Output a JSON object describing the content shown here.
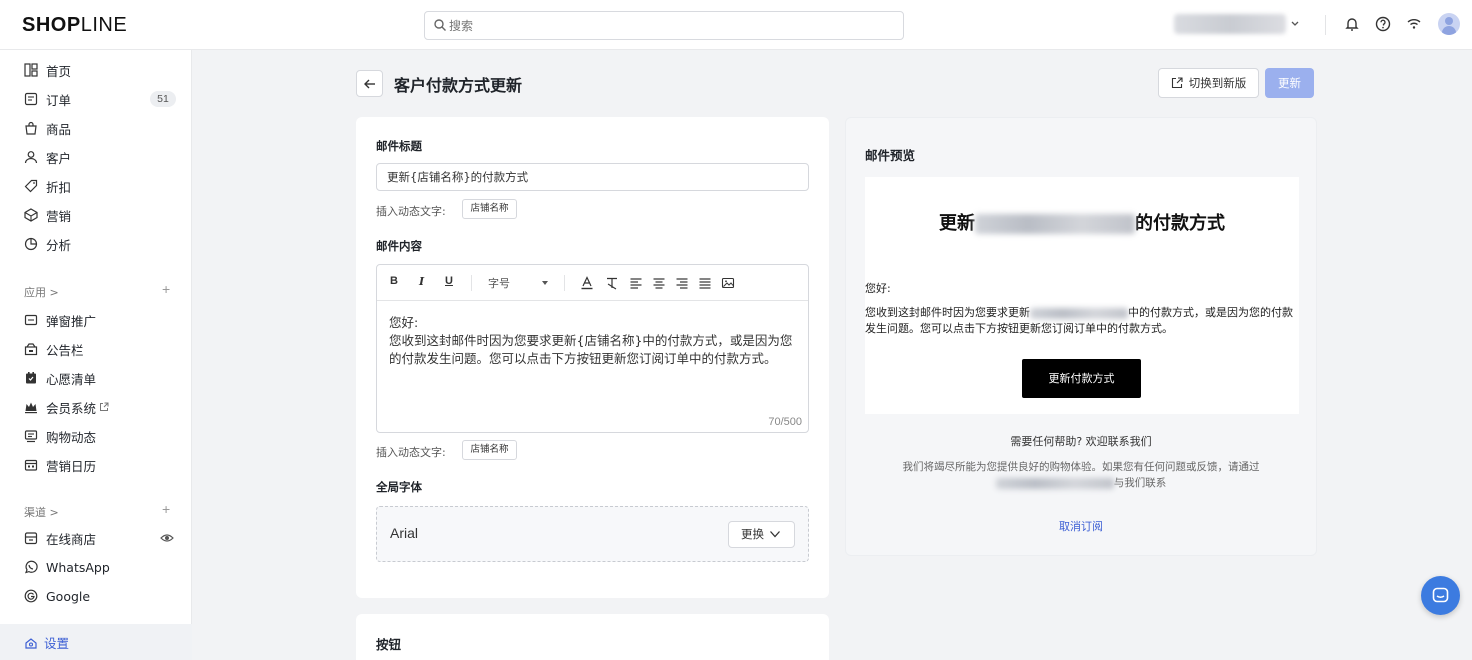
{
  "brand": {
    "logo_bold": "SH",
    "logo_o": "O",
    "logo_p": "P",
    "logo_light": "LINE"
  },
  "search": {
    "placeholder": "搜索"
  },
  "sidebar": {
    "items": [
      {
        "label": "首页",
        "icon": "home-icon"
      },
      {
        "label": "订单",
        "icon": "order-icon",
        "badge": "51"
      },
      {
        "label": "商品",
        "icon": "bag-icon"
      },
      {
        "label": "客户",
        "icon": "user-icon"
      },
      {
        "label": "折扣",
        "icon": "tag-icon"
      },
      {
        "label": "营销",
        "icon": "target-icon"
      },
      {
        "label": "分析",
        "icon": "chart-pie-icon"
      }
    ],
    "apps_label": "应用 >",
    "apps": [
      {
        "label": "弹窗推广",
        "icon": "popup-icon"
      },
      {
        "label": "公告栏",
        "icon": "announcement-icon"
      },
      {
        "label": "心愿清单",
        "icon": "wishlist-icon"
      },
      {
        "label": "会员系统",
        "icon": "crown-icon"
      },
      {
        "label": "购物动态",
        "icon": "activity-icon"
      },
      {
        "label": "营销日历",
        "icon": "calendar-icon"
      }
    ],
    "channels_label": "渠道 >",
    "channels": [
      {
        "label": "在线商店",
        "icon": "store-icon"
      },
      {
        "label": "WhatsApp",
        "icon": "whatsapp-icon"
      },
      {
        "label": "Google",
        "icon": "google-icon"
      }
    ],
    "settings_label": "设置"
  },
  "header": {
    "title": "客户付款方式更新",
    "switch_label": "切换到新版",
    "update_label": "更新"
  },
  "form": {
    "subject_label": "邮件标题",
    "subject_value": "更新{店铺名称}的付款方式",
    "insert_label": "插入动态文字:",
    "insert_tag": "店铺名称",
    "content_label": "邮件内容",
    "toolbar": {
      "bold": "B",
      "italic": "I",
      "underline": "U",
      "font_size": "字号"
    },
    "content_line1": "您好:",
    "content_line2": "您收到这封邮件时因为您要求更新{店铺名称}中的付款方式，或是因为您的付款发生问题。您可以点击下方按钮更新您订阅订单中的付款方式。",
    "counter": "70/500",
    "global_font_label": "全局字体",
    "font_value": "Arial",
    "change_label": "更换",
    "button_section_label": "按钮"
  },
  "preview": {
    "title": "邮件预览",
    "heading_pre": "更新",
    "heading_post": "的付款方式",
    "hello": "您好:",
    "body_pre": "您收到这封邮件时因为您要求更新",
    "body_post": "中的付款方式，或是因为您的付款发生问题。您可以点击下方按钮更新您订阅订单中的付款方式。",
    "cta": "更新付款方式",
    "help": "需要任何帮助? 欢迎联系我们",
    "footer_line1": "我们将竭尽所能为您提供良好的购物体验。如果您有任何问题或反馈，请通过",
    "footer_line2": "与我们联系",
    "unsubscribe": "取消订阅"
  },
  "colors": {
    "accent": "#3c5fd4",
    "update_button": "#9bb0ee",
    "chat": "#3c7be0"
  }
}
